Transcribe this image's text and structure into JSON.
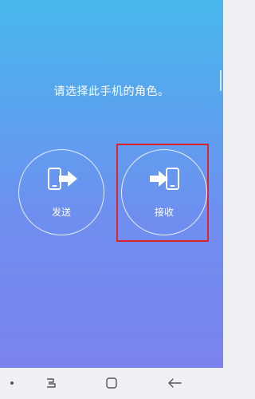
{
  "screen": {
    "prompt": "请选择此手机的角色。"
  },
  "roles": {
    "send": {
      "label": "发送",
      "icon": "phone-send-icon"
    },
    "receive": {
      "label": "接收",
      "icon": "phone-receive-icon"
    }
  },
  "colors": {
    "highlight": "#e0222c",
    "gradient_top": "#48b8ec",
    "gradient_bottom": "#7b82ee"
  },
  "navbar": {
    "items": [
      "dot-icon",
      "recents-icon",
      "home-icon",
      "back-icon"
    ]
  }
}
